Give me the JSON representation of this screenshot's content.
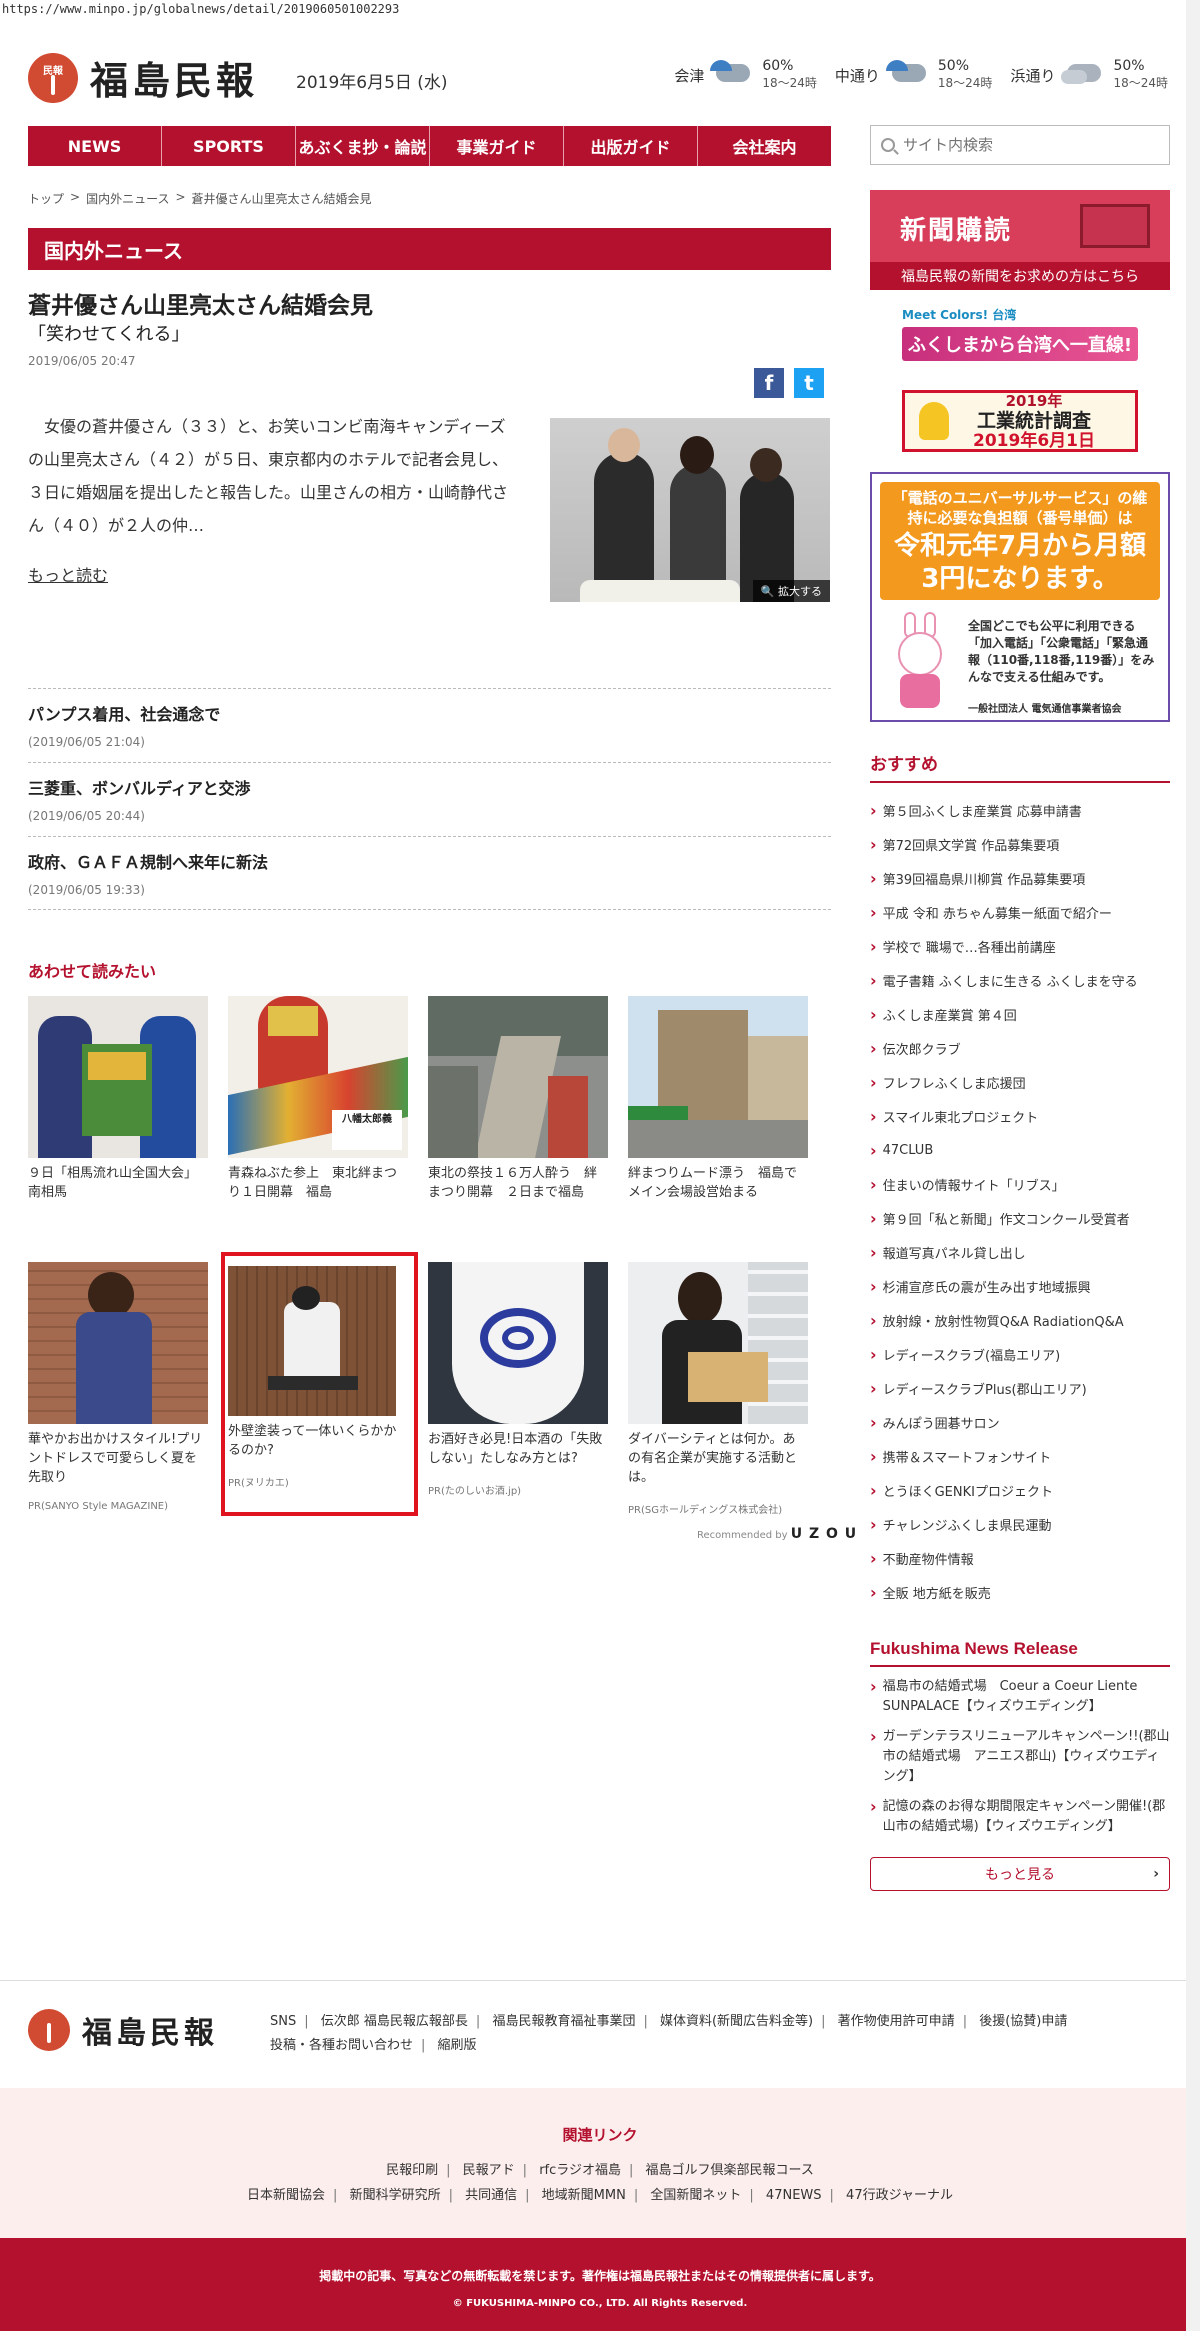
{
  "url": "https://www.minpo.jp/globalnews/detail/2019060501002293",
  "header": {
    "logo_badge": "民報",
    "logo_text": "福島民報",
    "date": "2019年6月5日 (水)",
    "weather": [
      {
        "area": "会津",
        "icon": "rain-cloud-icon",
        "pct": "60%",
        "time": "18〜24時"
      },
      {
        "area": "中通り",
        "icon": "rain-cloud-icon",
        "pct": "50%",
        "time": "18〜24時"
      },
      {
        "area": "浜通り",
        "icon": "cloud-icon",
        "pct": "50%",
        "time": "18〜24時"
      }
    ]
  },
  "nav": [
    "NEWS",
    "SPORTS",
    "あぶくま抄・論説",
    "事業ガイド",
    "出版ガイド",
    "会社案内"
  ],
  "search": {
    "placeholder": "サイト内検索"
  },
  "breadcrumb": [
    "トップ",
    "国内外ニュース",
    "蒼井優さん山里亮太さん結婚会見"
  ],
  "section_title": "国内外ニュース",
  "article": {
    "title": "蒼井優さん山里亮太さん結婚会見",
    "subtitle": "「笑わせてくれる」",
    "date": "2019/06/05 20:47",
    "body": "　女優の蒼井優さん（３３）と、お笑いコンビ南海キャンディーズの山里亮太さん（４２）が５日、東京都内のホテルで記者会見し、３日に婚姻届を提出したと報告した。山里さんの相方・山崎静代さん（４０）が２人の仲…",
    "more": "もっと読む",
    "zoom": "拡大する"
  },
  "news": [
    {
      "title": "パンプス着用、社会通念で",
      "date": "(2019/06/05 21:04)"
    },
    {
      "title": "三菱重、ボンバルディアと交渉",
      "date": "(2019/06/05 20:44)"
    },
    {
      "title": "政府、ＧＡＦＡ規制へ来年に新法",
      "date": "(2019/06/05 19:33)"
    }
  ],
  "related": {
    "heading": "あわせて読みたい",
    "row1": [
      {
        "text": "９日「相馬流れ山全国大会」 南相馬"
      },
      {
        "text": "青森ねぶた参上　東北絆まつり１日開幕　福島"
      },
      {
        "text": "東北の祭技１６万人酔う　絆まつり開幕　２日まで福島"
      },
      {
        "text": "絆まつりムード漂う　福島でメイン会場設営始まる"
      }
    ],
    "row2": [
      {
        "text": "華やかお出かけスタイル!プリントドレスで可愛らしく夏を先取り",
        "pr": "PR(SANYO Style MAGAZINE)"
      },
      {
        "text": "外壁塗装って一体いくらかかるのか?",
        "pr": "PR(ヌリカエ)"
      },
      {
        "text": "お酒好き必見!日本酒の「失敗しない」たしなみ方とは?",
        "pr": "PR(たのしいお酒.jp)"
      },
      {
        "text": "ダイバーシティとは何か。あの有名企業が実施する活動とは。",
        "pr": "PR(SGホールディングス株式会社)"
      }
    ],
    "recommended_prefix": "Recommended by",
    "recommended_brand": "U Z O U"
  },
  "sidebar": {
    "subscribe_title": "新聞購読",
    "subscribe_sub": "福島民報の新聞をお求めの方はこちら",
    "taiwan_top": "Meet Colors! 台湾",
    "taiwan_band": "ふくしまから台湾へ一直線!",
    "survey_l1": "2019年",
    "survey_l2": "工業統計調査",
    "survey_l3": "2019年6月1日",
    "phone_l1": "「電話のユニバーサルサービス」の維持に必要な負担額（番号単価）は",
    "phone_l2": "令和元年7月から月額3円になります。",
    "phone_small": "全国どこでも公平に利用できる「加入電話」「公衆電話」「緊急通報（110番,118番,119番）」をみんなで支える仕組みです。",
    "phone_org": "一般社団法人 電気通信事業者協会",
    "recommend_heading": "おすすめ",
    "recommend": [
      "第５回ふくしま産業賞 応募申請書",
      "第72回県文学賞 作品募集要項",
      "第39回福島県川柳賞 作品募集要項",
      "平成 令和 赤ちゃん募集ー紙面で紹介ー",
      "学校で 職場で…各種出前講座",
      "電子書籍 ふくしまに生きる ふくしまを守る",
      "ふくしま産業賞 第４回",
      "伝次郎クラブ",
      "フレフレふくしま応援団",
      "スマイル東北プロジェクト",
      "47CLUB",
      "住まいの情報サイト「リブス」",
      "第９回「私と新聞」作文コンクール受賞者",
      "報道写真パネル貸し出し",
      "杉浦宣彦氏の震が生み出す地域振興",
      "放射線・放射性物質Q&A RadiationQ&A",
      "レディースクラブ(福島エリア)",
      "レディースクラブPlus(郡山エリア)",
      "みんぽう囲碁サロン",
      "携帯＆スマートフォンサイト",
      "とうほくGENKIプロジェクト",
      "チャレンジふくしま県民運動",
      "不動産物件情報",
      "全販 地方紙を販売"
    ],
    "release_heading": "Fukushima News Release",
    "releases": [
      "福島市の結婚式場　Coeur a Coeur Liente SUNPALACE【ウィズウエディング】",
      "ガーデンテラスリニューアルキャンペーン!!(郡山市の結婚式場　アニエス郡山)【ウィズウエディング】",
      "記憶の森のお得な期間限定キャンペーン開催!(郡山市の結婚式場)【ウィズウエディング】"
    ],
    "more_btn": "もっと見る"
  },
  "footer": {
    "logo_text": "福島民報",
    "links": [
      "SNS",
      "伝次郎 福島民報広報部長",
      "福島民報教育福祉事業団",
      "媒体資料(新聞広告料金等)",
      "著作物使用許可申請",
      "後援(協賛)申請",
      "投稿・各種お問い合わせ",
      "縮刷版"
    ],
    "related_heading": "関連リンク",
    "related_row1": [
      "民報印刷",
      "民報アド",
      "rfcラジオ福島",
      "福島ゴルフ倶楽部民報コース"
    ],
    "related_row2": [
      "日本新聞協会",
      "新聞科学研究所",
      "共同通信",
      "地域新聞MMN",
      "全国新聞ネット",
      "47NEWS",
      "47行政ジャーナル"
    ],
    "copyright_notice": "掲載中の記事、写真などの無断転載を禁じます。著作権は福島民報社またはその情報提供者に属します。",
    "copyright": "© FUKUSHIMA-MINPO CO., LTD. All Rights Reserved."
  },
  "colors": {
    "brand": "#b4112e",
    "subscribe": "#d83d5a",
    "highlight": "#e0141e"
  }
}
